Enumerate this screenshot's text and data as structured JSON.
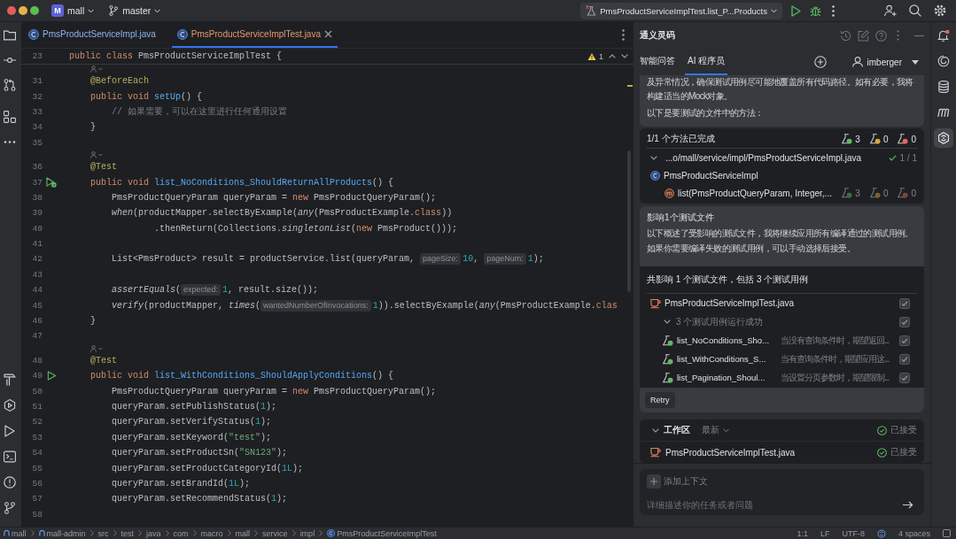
{
  "title_bar": {
    "project_badge": "M",
    "project": "mall",
    "branch": "master",
    "run_config": "PmsProductServiceImplTest.list_P...Products"
  },
  "editor_tabs": [
    {
      "label": "PmsProductServiceImpl.java",
      "color": "#8fb4f0",
      "selected": false
    },
    {
      "label": "PmsProductServiceImplTest.java",
      "color": "#e39a6c",
      "selected": true
    }
  ],
  "editor": {
    "problems": "1",
    "sticky_line": {
      "number": "23",
      "tokens": [
        {
          "text": "public class ",
          "kind": "keyword"
        },
        {
          "text": "PmsProductServiceImplTest {",
          "kind": "plain"
        }
      ]
    },
    "lines": [
      {
        "kind": "vision"
      },
      {
        "kind": "code",
        "number": "31",
        "tokens": [
          {
            "text": "    @BeforeEach",
            "kind": "annotation"
          }
        ]
      },
      {
        "kind": "code",
        "number": "32",
        "tokens": [
          {
            "text": "    public void ",
            "kind": "keyword"
          },
          {
            "text": "setUp",
            "kind": "declaration"
          },
          {
            "text": "() {",
            "kind": "plain"
          }
        ]
      },
      {
        "kind": "code",
        "number": "33",
        "tokens": [
          {
            "text": "        // 如果需要，可以在这里进行任何通用设置",
            "kind": "comment"
          }
        ]
      },
      {
        "kind": "code",
        "number": "34",
        "tokens": [
          {
            "text": "    }",
            "kind": "plain"
          }
        ]
      },
      {
        "kind": "code",
        "number": "35"
      },
      {
        "kind": "vision"
      },
      {
        "kind": "code",
        "number": "36",
        "tokens": [
          {
            "text": "    @Test",
            "kind": "annotation"
          }
        ]
      },
      {
        "kind": "code",
        "number": "37",
        "gutter": {
          "kind": "run",
          "passed": true
        },
        "tokens": [
          {
            "text": "    public void ",
            "kind": "keyword"
          },
          {
            "text": "list_NoConditions_ShouldReturnAllProducts",
            "kind": "declaration"
          },
          {
            "text": "() {",
            "kind": "plain"
          }
        ]
      },
      {
        "kind": "code",
        "number": "38",
        "tokens": [
          {
            "text": "        PmsProductQueryParam queryParam = ",
            "kind": "plain"
          },
          {
            "text": "new",
            "kind": "keyword"
          },
          {
            "text": " PmsProductQueryParam();",
            "kind": "plain"
          }
        ]
      },
      {
        "kind": "code",
        "number": "39",
        "tokens": [
          {
            "text": "        when",
            "kind": "static"
          },
          {
            "text": "(productMapper.selectByExample(",
            "kind": "plain"
          },
          {
            "text": "any",
            "kind": "static"
          },
          {
            "text": "(PmsProductExample.",
            "kind": "plain"
          },
          {
            "text": "class",
            "kind": "keyword"
          },
          {
            "text": "))",
            "kind": "plain"
          }
        ]
      },
      {
        "kind": "code",
        "number": "40",
        "tokens": [
          {
            "text": "                .thenReturn(Collections.",
            "kind": "plain"
          },
          {
            "text": "singletonList",
            "kind": "static"
          },
          {
            "text": "(",
            "kind": "plain"
          },
          {
            "text": "new",
            "kind": "keyword"
          },
          {
            "text": " PmsProduct()));",
            "kind": "plain"
          }
        ]
      },
      {
        "kind": "code",
        "number": "41"
      },
      {
        "kind": "code",
        "number": "42",
        "tokens": [
          {
            "text": "        List<PmsProduct> result = productService.list(queryParam, ",
            "kind": "plain"
          },
          {
            "text": "pageSize:",
            "kind": "hint"
          },
          {
            "text": "10",
            "kind": "number"
          },
          {
            "text": ", ",
            "kind": "plain"
          },
          {
            "text": "pageNum:",
            "kind": "hint"
          },
          {
            "text": "1",
            "kind": "number"
          },
          {
            "text": ");",
            "kind": "plain"
          }
        ]
      },
      {
        "kind": "code",
        "number": "43"
      },
      {
        "kind": "code",
        "number": "44",
        "tokens": [
          {
            "text": "        assertEquals",
            "kind": "static"
          },
          {
            "text": "(",
            "kind": "plain"
          },
          {
            "text": "expected:",
            "kind": "hint"
          },
          {
            "text": "1",
            "kind": "number"
          },
          {
            "text": ", result.size());",
            "kind": "plain"
          }
        ]
      },
      {
        "kind": "code",
        "number": "45",
        "tokens": [
          {
            "text": "        verify",
            "kind": "static"
          },
          {
            "text": "(productMapper, ",
            "kind": "plain"
          },
          {
            "text": "times",
            "kind": "static"
          },
          {
            "text": "(",
            "kind": "plain"
          },
          {
            "text": "wantedNumberOfInvocations:",
            "kind": "hint"
          },
          {
            "text": "1",
            "kind": "number"
          },
          {
            "text": ")).selectByExample(",
            "kind": "plain"
          },
          {
            "text": "any",
            "kind": "static"
          },
          {
            "text": "(PmsProductExample.",
            "kind": "plain"
          },
          {
            "text": "clas",
            "kind": "keyword"
          }
        ]
      },
      {
        "kind": "code",
        "number": "46",
        "tokens": [
          {
            "text": "    }",
            "kind": "plain"
          }
        ]
      },
      {
        "kind": "code",
        "number": "47"
      },
      {
        "kind": "vision"
      },
      {
        "kind": "code",
        "number": "48",
        "tokens": [
          {
            "text": "    @Test",
            "kind": "annotation"
          }
        ]
      },
      {
        "kind": "code",
        "number": "49",
        "gutter": {
          "kind": "run",
          "passed": false
        },
        "tokens": [
          {
            "text": "    public void ",
            "kind": "keyword"
          },
          {
            "text": "list_WithConditions_ShouldApplyConditions",
            "kind": "declaration"
          },
          {
            "text": "() {",
            "kind": "plain"
          }
        ]
      },
      {
        "kind": "code",
        "number": "50",
        "tokens": [
          {
            "text": "        PmsProductQueryParam queryParam = ",
            "kind": "plain"
          },
          {
            "text": "new",
            "kind": "keyword"
          },
          {
            "text": " PmsProductQueryParam();",
            "kind": "plain"
          }
        ]
      },
      {
        "kind": "code",
        "number": "51",
        "tokens": [
          {
            "text": "        queryParam.setPublishStatus(",
            "kind": "plain"
          },
          {
            "text": "1",
            "kind": "number"
          },
          {
            "text": ");",
            "kind": "plain"
          }
        ]
      },
      {
        "kind": "code",
        "number": "52",
        "tokens": [
          {
            "text": "        queryParam.setVerifyStatus(",
            "kind": "plain"
          },
          {
            "text": "1",
            "kind": "number"
          },
          {
            "text": ");",
            "kind": "plain"
          }
        ]
      },
      {
        "kind": "code",
        "number": "53",
        "tokens": [
          {
            "text": "        queryParam.setKeyword(",
            "kind": "plain"
          },
          {
            "text": "\"test\"",
            "kind": "string"
          },
          {
            "text": ");",
            "kind": "plain"
          }
        ]
      },
      {
        "kind": "code",
        "number": "54",
        "tokens": [
          {
            "text": "        queryParam.setProductSn(",
            "kind": "plain"
          },
          {
            "text": "\"SN123\"",
            "kind": "string"
          },
          {
            "text": ");",
            "kind": "plain"
          }
        ]
      },
      {
        "kind": "code",
        "number": "55",
        "tokens": [
          {
            "text": "        queryParam.setProductCategoryId(",
            "kind": "plain"
          },
          {
            "text": "1L",
            "kind": "number"
          },
          {
            "text": ");",
            "kind": "plain"
          }
        ]
      },
      {
        "kind": "code",
        "number": "56",
        "tokens": [
          {
            "text": "        queryParam.setBrandId(",
            "kind": "plain"
          },
          {
            "text": "1L",
            "kind": "number"
          },
          {
            "text": ");",
            "kind": "plain"
          }
        ]
      },
      {
        "kind": "code",
        "number": "57",
        "tokens": [
          {
            "text": "        queryParam.setRecommendStatus(",
            "kind": "plain"
          },
          {
            "text": "1",
            "kind": "number"
          },
          {
            "text": ");",
            "kind": "plain"
          }
        ]
      },
      {
        "kind": "code",
        "number": "58"
      }
    ]
  },
  "assistant": {
    "title": "通义灵码",
    "tabs": [
      {
        "label": "智能问答",
        "selected": false
      },
      {
        "label": "AI 程序员",
        "selected": true
      }
    ],
    "user": "imberger",
    "intro": {
      "paragraph": "及异常情况，确保测试用例尽可能地覆盖所有代码路径。如有必要，我将构建适当的Mock对象。",
      "methods_heading": "以下是要测试的文件中的方法："
    },
    "methods": {
      "heading": "1/1 个方法已完成",
      "counts": [
        {
          "kind": "passed",
          "value": "3"
        },
        {
          "kind": "warning",
          "value": "0"
        },
        {
          "kind": "failed",
          "value": "0"
        }
      ],
      "file": {
        "path": "...o/mall/service/impl/PmsProductServiceImpl.java",
        "progress": "1 / 1",
        "expanded": true
      },
      "class_name": "PmsProductServiceImpl",
      "method": {
        "signature": "list(PmsProductQueryParam, Integer,...",
        "counts": [
          {
            "kind": "passed",
            "value": "3"
          },
          {
            "kind": "warning",
            "value": "0"
          },
          {
            "kind": "failed",
            "value": "0"
          }
        ]
      }
    },
    "impact": {
      "heading": "影响1个测试文件",
      "paragraph": "以下概述了受影响的测试文件，我将继续应用所有编译通过的测试用例。如果你需要编译失败的测试用例，可以手动选择后接受。",
      "summary": "共影响 1 个测试文件，包括 3 个测试用例",
      "file": {
        "name": "PmsProductServiceImplTest.java",
        "checked": true,
        "disabled": true
      },
      "group": {
        "label": "3 个测试用例运行成功",
        "expanded": true,
        "checked": true,
        "disabled": true
      },
      "tests": [
        {
          "name": "list_NoConditions_Sho...",
          "description": "当没有查询条件时，期望返回...",
          "passed": true,
          "checked": true,
          "disabled": true
        },
        {
          "name": "list_WithConditions_S...",
          "description": "当有查询条件时，期望应用这...",
          "passed": true,
          "checked": true,
          "disabled": true
        },
        {
          "name": "list_Pagination_Shoul...",
          "description": "当设置分页参数时，期望限制...",
          "passed": true,
          "checked": true,
          "disabled": true
        }
      ],
      "retry": "Retry"
    },
    "workspace": {
      "title": "工作区",
      "filter": "最新",
      "status": "已接受",
      "expanded": true,
      "files": [
        {
          "name": "PmsProductServiceImplTest.java",
          "status": "已接受"
        }
      ]
    },
    "composer": {
      "add_context": "添加上下文",
      "placeholder": "详细描述你的任务或者问题"
    }
  },
  "right_toolbar": [
    {
      "selected": false
    },
    {
      "selected": false
    },
    {
      "selected": false
    },
    {
      "selected": true
    }
  ],
  "status_bar": {
    "breadcrumbs": [
      {
        "label": "mall",
        "kind": "module"
      },
      {
        "label": "mall-admin",
        "kind": "module"
      },
      {
        "label": "src",
        "kind": "folder"
      },
      {
        "label": "test",
        "kind": "folder"
      },
      {
        "label": "java",
        "kind": "folder"
      },
      {
        "label": "com",
        "kind": "folder"
      },
      {
        "label": "macro",
        "kind": "folder"
      },
      {
        "label": "mall",
        "kind": "folder"
      },
      {
        "label": "service",
        "kind": "folder"
      },
      {
        "label": "impl",
        "kind": "folder"
      },
      {
        "label": "PmsProductServiceImplTest",
        "kind": "class"
      }
    ],
    "position": "1:1",
    "line_separator": "LF",
    "encoding": "UTF-8",
    "indent": "4 spaces"
  }
}
